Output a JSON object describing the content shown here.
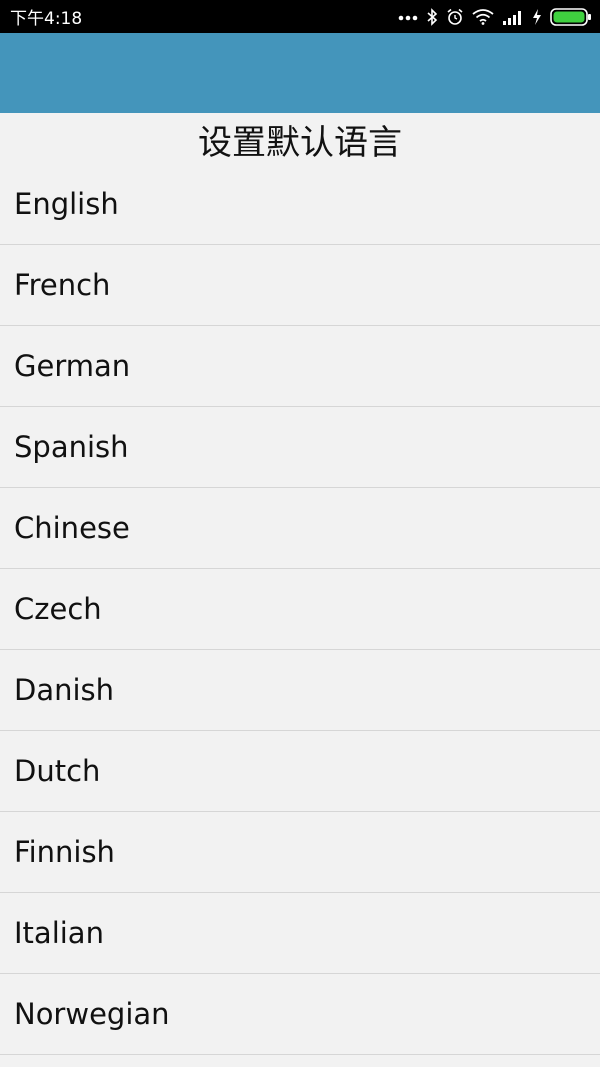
{
  "status_bar": {
    "time": "下午4:18",
    "icons": [
      "more-dots-icon",
      "bluetooth-icon",
      "alarm-icon",
      "wifi-icon",
      "signal-icon",
      "charging-icon",
      "battery-icon"
    ]
  },
  "app_bar": {
    "color": "#4495bb"
  },
  "page": {
    "title": "设置默认语言"
  },
  "languages": [
    {
      "label": "English"
    },
    {
      "label": "French"
    },
    {
      "label": "German"
    },
    {
      "label": "Spanish"
    },
    {
      "label": "Chinese"
    },
    {
      "label": "Czech"
    },
    {
      "label": "Danish"
    },
    {
      "label": "Dutch"
    },
    {
      "label": "Finnish"
    },
    {
      "label": "Italian"
    },
    {
      "label": "Norwegian"
    }
  ]
}
